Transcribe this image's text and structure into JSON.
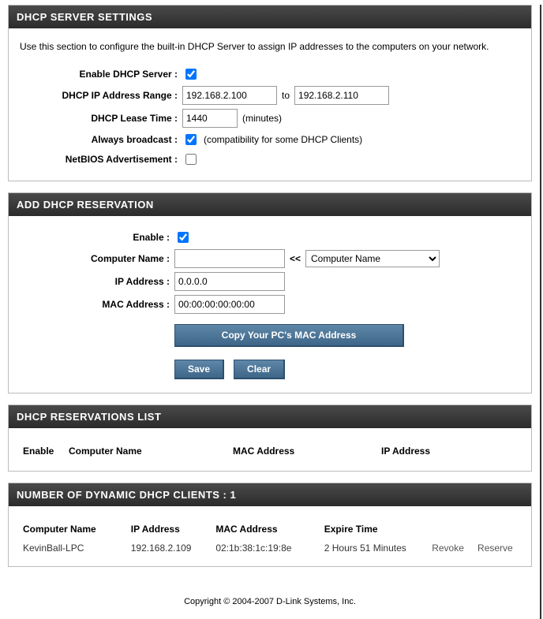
{
  "dhcp_settings": {
    "title": "DHCP SERVER SETTINGS",
    "intro": "Use this section to configure the built-in DHCP Server to assign IP addresses to the computers on your network.",
    "enable_label": "Enable DHCP Server :",
    "range_label": "DHCP IP Address Range :",
    "range_from": "192.168.2.100",
    "range_to_word": "to",
    "range_to": "192.168.2.110",
    "lease_label": "DHCP Lease Time :",
    "lease_value": "1440",
    "lease_unit": "(minutes)",
    "broadcast_label": "Always broadcast :",
    "broadcast_hint": "(compatibility for some DHCP Clients)",
    "netbios_label": "NetBIOS Advertisement :"
  },
  "reservation_form": {
    "title": "ADD DHCP RESERVATION",
    "enable_label": "Enable :",
    "name_label": "Computer Name :",
    "ip_label": "IP Address :",
    "ip_value": "0.0.0.0",
    "mac_label": "MAC Address :",
    "mac_value": "00:00:00:00:00:00",
    "arrows": "<<",
    "name_select": "Computer Name",
    "copy_btn": "Copy Your PC's MAC Address",
    "save_btn": "Save",
    "clear_btn": "Clear"
  },
  "reservations_list": {
    "title": "DHCP RESERVATIONS LIST",
    "col_enable": "Enable",
    "col_name": "Computer Name",
    "col_mac": "MAC Address",
    "col_ip": "IP Address"
  },
  "dynamic_clients": {
    "title": "NUMBER OF DYNAMIC DHCP CLIENTS : 1",
    "col_name": "Computer Name",
    "col_ip": "IP Address",
    "col_mac": "MAC Address",
    "col_expire": "Expire Time",
    "rows": [
      {
        "name": "KevinBall-LPC",
        "ip": "192.168.2.109",
        "mac": "02:1b:38:1c:19:8e",
        "expire": "2 Hours 51 Minutes",
        "revoke": "Revoke",
        "reserve": "Reserve"
      }
    ]
  },
  "footer": "Copyright © 2004-2007 D-Link Systems, Inc."
}
